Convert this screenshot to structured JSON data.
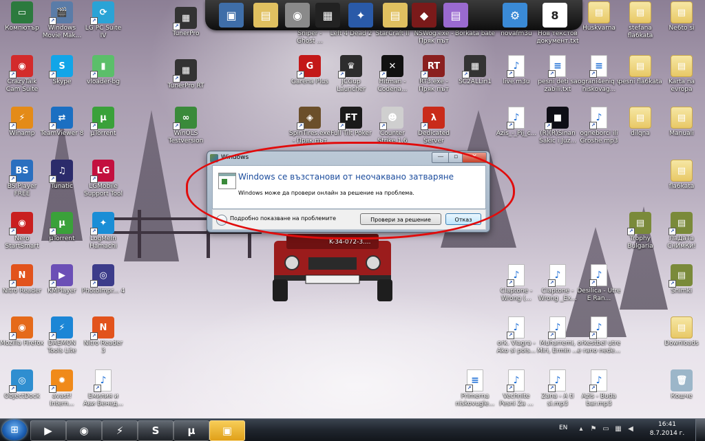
{
  "desktop_icons": [
    {
      "label": "Компютър",
      "glyph": "▭",
      "color": "#2c7a3e"
    },
    {
      "label": "Windows Movie Mak...",
      "glyph": "🎬",
      "color": "#5a7ca8"
    },
    {
      "label": "LG PC Suite IV",
      "glyph": "⟳",
      "color": "#2aa3d6"
    },
    {
      "label": "TunerPro",
      "glyph": "▦",
      "color": "#333333"
    },
    {
      "label": "CrazyTalk Cam Suite",
      "glyph": "◉",
      "color": "#d32b2b"
    },
    {
      "label": "Skype",
      "glyph": "S",
      "color": "#12a5e8"
    },
    {
      "label": "vloader-bg",
      "glyph": "▮",
      "color": "#5bbf6a"
    },
    {
      "label": "TunerPro RT",
      "glyph": "▦",
      "color": "#333333"
    },
    {
      "label": "Garena Plus",
      "glyph": "G",
      "color": "#c31818"
    },
    {
      "label": "JCGup Launcher",
      "glyph": "♛",
      "color": "#2d2d2d"
    },
    {
      "label": "Hitman - Codena...",
      "glyph": "✕",
      "color": "#111111"
    },
    {
      "label": "RT3.exe - Пряк път",
      "glyph": "RT",
      "color": "#8a1f1f"
    },
    {
      "label": "SC2ALLin1",
      "glyph": "▦",
      "color": "#333333"
    },
    {
      "label": "live.m3u",
      "glyph": "♪",
      "color": "#ffffff"
    },
    {
      "label": "pesni deti sa zabili.txt",
      "glyph": "≡",
      "color": "#ffffff"
    },
    {
      "label": "ograni4eniq v niskovag...",
      "glyph": "≡",
      "color": "#ffffff"
    },
    {
      "label": "pesni fla6kata",
      "glyph": "▤",
      "color": "#e8c866"
    },
    {
      "label": "Karta na evropa",
      "glyph": "▤",
      "color": "#e8c866"
    },
    {
      "label": "Winamp",
      "glyph": "⚡",
      "color": "#e48b18"
    },
    {
      "label": "TeamViewer 8",
      "glyph": "⇄",
      "color": "#1b6fc2"
    },
    {
      "label": "µTorrent",
      "glyph": "µ",
      "color": "#3aa13a"
    },
    {
      "label": "WinOLS Testversion",
      "glyph": "∞",
      "color": "#3a8a3a"
    },
    {
      "label": "SpinTires.exe - Пряк път",
      "glyph": "◈",
      "color": "#6b4f2a"
    },
    {
      "label": "Full Tilt Poker",
      "glyph": "FT",
      "color": "#1a1a1a"
    },
    {
      "label": "Counter Strike 1.6",
      "glyph": "☻",
      "color": "#cfcfcf"
    },
    {
      "label": "Dedicated Server",
      "glyph": "λ",
      "color": "#c92b1a"
    },
    {
      "label": "Azis_-_Pij_c...",
      "glyph": "♪",
      "color": "#ffffff"
    },
    {
      "label": "(R)(R)Sinan Sakic i Juz...",
      "glyph": "■",
      "color": "#0e0e16"
    },
    {
      "label": "ogneborci ili Groshe.mp3",
      "glyph": "♪",
      "color": "#ffffff"
    },
    {
      "label": "dilqna",
      "glyph": "▤",
      "color": "#e8c866"
    },
    {
      "label": "Manuali",
      "glyph": "▤",
      "color": "#e8c866"
    },
    {
      "label": "BS.Player FREE",
      "glyph": "BS",
      "color": "#2a6fbf"
    },
    {
      "label": "Tunatic",
      "glyph": "♫",
      "color": "#2b2b6b"
    },
    {
      "label": "LGMobile Support Tool",
      "glyph": "LG",
      "color": "#c3103f"
    },
    {
      "label": "fla6kata",
      "glyph": "▤",
      "color": "#e8c866"
    },
    {
      "label": "Nero StartSmart",
      "glyph": "◉",
      "color": "#c91f1f"
    },
    {
      "label": "µTorrent",
      "glyph": "µ",
      "color": "#3aa13a"
    },
    {
      "label": "LogMeIn Hamachi",
      "glyph": "✦",
      "color": "#1a8ed6"
    },
    {
      "label": "Trophy Bulgaria",
      "glyph": "▤",
      "color": "#7a8a3a"
    },
    {
      "label": "ЛаДаТа СнИмКи!",
      "glyph": "▤",
      "color": "#7a8a3a"
    },
    {
      "label": "Nitro Reader",
      "glyph": "N",
      "color": "#e2531c"
    },
    {
      "label": "KMPlayer",
      "glyph": "▶",
      "color": "#6b4fb6"
    },
    {
      "label": "PhotoImpr... 4",
      "glyph": "◎",
      "color": "#3c3c8a"
    },
    {
      "label": "Claptone - Wrong (...",
      "glyph": "♪",
      "color": "#ffffff"
    },
    {
      "label": "Claptone - Wrong _Ex...",
      "glyph": "♪",
      "color": "#ffffff"
    },
    {
      "label": "Desilica - Utre E Ran...",
      "glyph": "♪",
      "color": "#ffffff"
    },
    {
      "label": "Snimki",
      "glyph": "▤",
      "color": "#7a8a3a"
    },
    {
      "label": "Mozilla Firefox",
      "glyph": "◉",
      "color": "#e56a1a"
    },
    {
      "label": "DAEMON Tools Lite",
      "glyph": "⚡",
      "color": "#1c86d6"
    },
    {
      "label": "Nitro Reader 3",
      "glyph": "N",
      "color": "#e2531c"
    },
    {
      "label": "ork. Viagra - Ako si pois...",
      "glyph": "♪",
      "color": "#ffffff"
    },
    {
      "label": "Muharremi, Miri, Ermin ...",
      "glyph": "♪",
      "color": "#ffffff"
    },
    {
      "label": "orkestbel utre e rano nede...",
      "glyph": "♪",
      "color": "#ffffff"
    },
    {
      "label": "Downloads",
      "glyph": "▤",
      "color": "#e8c866"
    },
    {
      "label": "ObjectDock",
      "glyph": "◎",
      "color": "#2f8ed0"
    },
    {
      "label": "avast! Intern...",
      "glyph": "✹",
      "color": "#f08a1a"
    },
    {
      "label": "Емилия и Ави Бенед...",
      "glyph": "♪",
      "color": "#ffffff"
    },
    {
      "label": "Primerna niskovugle...",
      "glyph": "≡",
      "color": "#ffffff"
    },
    {
      "label": "Vechnite Pesni Za ...",
      "glyph": "♪",
      "color": "#ffffff"
    },
    {
      "label": "Zana - A ti si.mp3",
      "glyph": "♪",
      "color": "#ffffff"
    },
    {
      "label": "Azis - Buda bar.mp3",
      "glyph": "♪",
      "color": "#ffffff"
    },
    {
      "label": "Кошче",
      "glyph": "🗑",
      "color": "#9cb6c9"
    },
    {
      "label": "Sniper - Ghost ...",
      "glyph": "",
      "color": "#444444"
    },
    {
      "label": "Left 4 Dead 2",
      "glyph": "",
      "color": "#444444"
    },
    {
      "label": "StarCraft II",
      "glyph": "",
      "color": "#444444"
    },
    {
      "label": "NSWog.exe - Пряк път",
      "glyph": "",
      "color": "#444444"
    },
    {
      "label": "Borkata bate",
      "glyph": "",
      "color": "#444444"
    },
    {
      "label": "novafm3u",
      "glyph": "",
      "color": "#444444"
    },
    {
      "label": "Нов текстов документ.txt",
      "glyph": "",
      "color": "#444444"
    },
    {
      "label": "Huskvarna",
      "glyph": "▤",
      "color": "#e8c866"
    },
    {
      "label": "stefana fla6kata",
      "glyph": "▤",
      "color": "#e8c866"
    },
    {
      "label": "Ne6to si",
      "glyph": "▤",
      "color": "#e8c866"
    }
  ],
  "dock_items": [
    {
      "name": "monitor",
      "glyph": "▣",
      "color": "#3f6ea8"
    },
    {
      "name": "folder",
      "glyph": "▤",
      "color": "#e0c060"
    },
    {
      "name": "disc",
      "glyph": "◉",
      "color": "#8a8a8a"
    },
    {
      "name": "chip",
      "glyph": "▦",
      "color": "#222222"
    },
    {
      "name": "starcraft",
      "glyph": "✦",
      "color": "#2a5aa8"
    },
    {
      "name": "folder2",
      "glyph": "▤",
      "color": "#e0c060"
    },
    {
      "name": "shield",
      "glyph": "◆",
      "color": "#7a1a1a"
    },
    {
      "name": "folder3",
      "glyph": "▤",
      "color": "#9a6ad0"
    },
    {
      "name": "settings",
      "glyph": "⚙",
      "color": "#3a8ad6"
    },
    {
      "name": "calendar",
      "glyph": "8",
      "color": "#ffffff"
    }
  ],
  "dialog": {
    "title": "Windows",
    "heading": "Windows се възстанови от неочаквано затваряне",
    "message": "Windows може да провери онлайн за решение на проблема.",
    "details_label": "Подробно показване на проблемите",
    "check_button": "Провери за решение",
    "cancel_button": "Отказ",
    "minimize": "—",
    "maximize": "▫",
    "close": "✕"
  },
  "car_plate": "K-34-072-3....",
  "taskbar": {
    "start_glyph": "⊞",
    "buttons": [
      {
        "name": "media-player",
        "glyph": "▶",
        "active": false
      },
      {
        "name": "firefox",
        "glyph": "◉",
        "active": false
      },
      {
        "name": "winamp",
        "glyph": "⚡",
        "active": false
      },
      {
        "name": "skype",
        "glyph": "S",
        "active": false
      },
      {
        "name": "utorrent",
        "glyph": "µ",
        "active": false
      },
      {
        "name": "windows-dialog",
        "glyph": "▣",
        "active": true
      }
    ],
    "language": "EN",
    "time": "16:41",
    "date": "8.7.2014 г."
  }
}
